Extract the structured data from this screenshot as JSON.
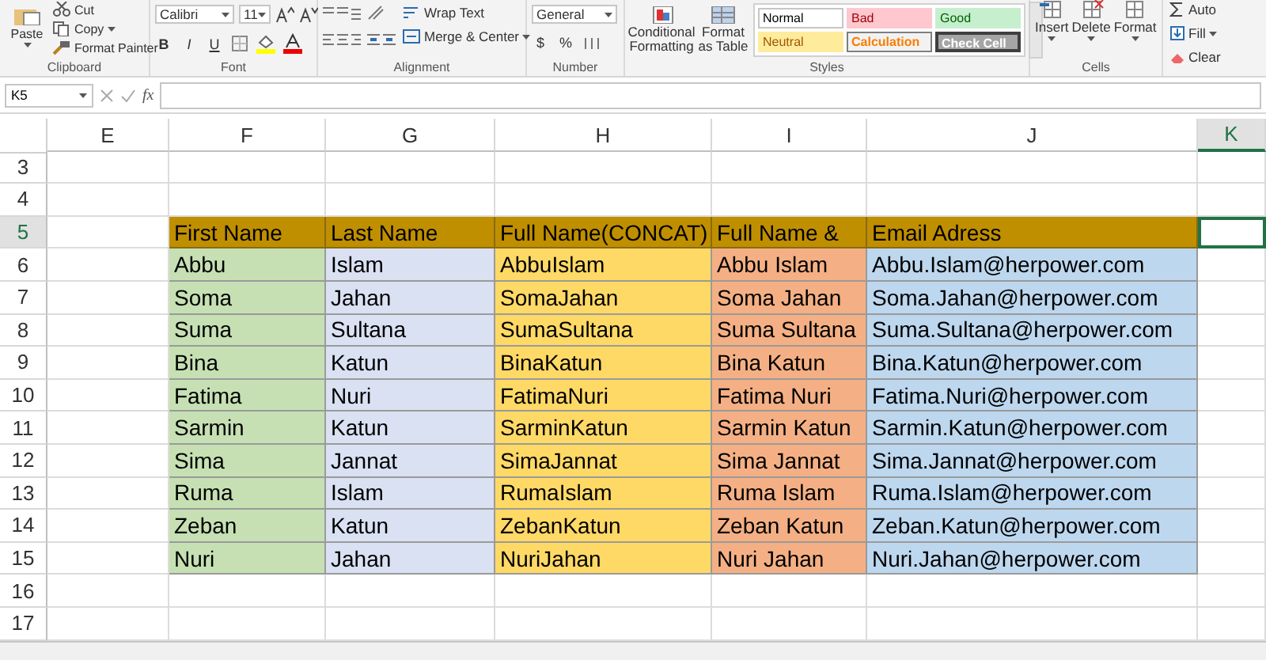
{
  "ribbon": {
    "groups": [
      {
        "kind": "clipboard",
        "label": "Clipboard",
        "paste": "Paste",
        "items": [
          "Cut",
          "Copy",
          "Format Painter"
        ]
      },
      {
        "kind": "font",
        "label": "Font",
        "font": "Calibri",
        "size": "11",
        "buttons": [
          "B",
          "I",
          "U"
        ]
      },
      {
        "kind": "alignment",
        "label": "Alignment",
        "buttons": [
          "Wrap Text",
          "Merge & Center"
        ]
      },
      {
        "kind": "number",
        "label": "Number",
        "format": "General",
        "buttons": [
          "$",
          "%"
        ]
      },
      {
        "kind": "styles",
        "label": "Styles",
        "buttons": [
          "Conditional Formatting",
          "Format as Table"
        ],
        "styles": [
          {
            "label": "Normal",
            "kind": "normal"
          },
          {
            "label": "Bad",
            "kind": "bad"
          },
          {
            "label": "Good",
            "kind": "good"
          },
          {
            "label": "Neutral",
            "kind": "neutral"
          },
          {
            "label": "Calculation",
            "kind": "calc"
          },
          {
            "label": "Check Cell",
            "kind": "check"
          }
        ]
      },
      {
        "kind": "cells",
        "label": "Cells",
        "buttons": [
          "Insert",
          "Delete",
          "Format"
        ]
      },
      {
        "kind": "editing",
        "buttons": [
          "Auto",
          "Fill",
          "Clear"
        ]
      }
    ]
  },
  "formula_bar": {
    "name_box": "K5",
    "fx": "fx"
  },
  "table": {
    "columns": [
      {
        "label": "E",
        "selected": false
      },
      {
        "label": "F",
        "selected": false,
        "color": "#c6e0b4"
      },
      {
        "label": "G",
        "selected": false,
        "color": "#d9e1f2"
      },
      {
        "label": "H",
        "selected": false,
        "color": "#ffd966"
      },
      {
        "label": "I",
        "selected": false,
        "color": "#f4b084"
      },
      {
        "label": "J",
        "selected": false,
        "color": "#bdd7ee"
      },
      {
        "label": "K",
        "selected": true
      }
    ],
    "rows": [
      {
        "number": "3",
        "kind": "blank",
        "selected": false
      },
      {
        "number": "4",
        "kind": "blank",
        "selected": false
      },
      {
        "number": "5",
        "kind": "header",
        "selected": true,
        "cells": [
          "First Name",
          "Last Name",
          "Full Name(CONCAT)",
          "Full Name &",
          "Email Adress"
        ]
      },
      {
        "number": "6",
        "kind": "data",
        "selected": false,
        "cells": [
          "Abbu",
          "Islam",
          "AbbuIslam",
          "Abbu Islam",
          "Abbu.Islam@herpower.com"
        ]
      },
      {
        "number": "7",
        "kind": "data",
        "selected": false,
        "cells": [
          "Soma",
          "Jahan",
          "SomaJahan",
          "Soma Jahan",
          "Soma.Jahan@herpower.com"
        ]
      },
      {
        "number": "8",
        "kind": "data",
        "selected": false,
        "cells": [
          "Suma",
          "Sultana",
          "SumaSultana",
          "Suma Sultana",
          "Suma.Sultana@herpower.com"
        ]
      },
      {
        "number": "9",
        "kind": "data",
        "selected": false,
        "cells": [
          "Bina",
          "Katun",
          "BinaKatun",
          "Bina Katun",
          "Bina.Katun@herpower.com"
        ]
      },
      {
        "number": "10",
        "kind": "data",
        "selected": false,
        "cells": [
          "Fatima",
          "Nuri",
          "FatimaNuri",
          "Fatima Nuri",
          "Fatima.Nuri@herpower.com"
        ]
      },
      {
        "number": "11",
        "kind": "data",
        "selected": false,
        "cells": [
          "Sarmin",
          "Katun",
          "SarminKatun",
          "Sarmin Katun",
          "Sarmin.Katun@herpower.com"
        ]
      },
      {
        "number": "12",
        "kind": "data",
        "selected": false,
        "cells": [
          "Sima",
          "Jannat",
          "SimaJannat",
          "Sima Jannat",
          "Sima.Jannat@herpower.com"
        ]
      },
      {
        "number": "13",
        "kind": "data",
        "selected": false,
        "cells": [
          "Ruma",
          "Islam",
          "RumaIslam",
          "Ruma Islam",
          "Ruma.Islam@herpower.com"
        ]
      },
      {
        "number": "14",
        "kind": "data",
        "selected": false,
        "cells": [
          "Zeban",
          "Katun",
          "ZebanKatun",
          "Zeban Katun",
          "Zeban.Katun@herpower.com"
        ]
      },
      {
        "number": "15",
        "kind": "data",
        "selected": false,
        "cells": [
          "Nuri",
          "Jahan",
          "NuriJahan",
          "Nuri Jahan",
          "Nuri.Jahan@herpower.com"
        ]
      },
      {
        "number": "16",
        "kind": "blank",
        "selected": false
      },
      {
        "number": "17",
        "kind": "blank",
        "selected": false
      }
    ]
  }
}
